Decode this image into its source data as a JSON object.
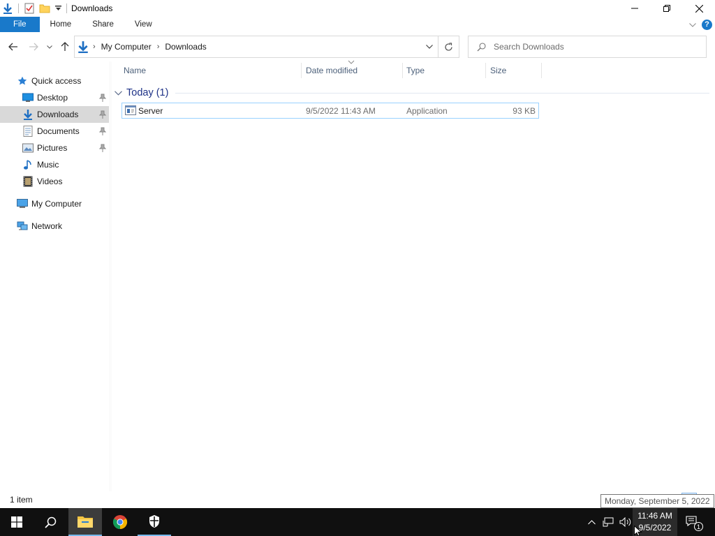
{
  "window": {
    "title": "Downloads"
  },
  "ribbon": {
    "tabs": [
      "File",
      "Home",
      "Share",
      "View"
    ]
  },
  "address": {
    "crumbs": [
      "My Computer",
      "Downloads"
    ]
  },
  "search": {
    "placeholder": "Search Downloads"
  },
  "nav_pane": {
    "quick_access": "Quick access",
    "items": [
      {
        "label": "Desktop",
        "icon": "desktop-icon",
        "pinned": true
      },
      {
        "label": "Downloads",
        "icon": "downloads-icon",
        "pinned": true,
        "selected": true
      },
      {
        "label": "Documents",
        "icon": "documents-icon",
        "pinned": true
      },
      {
        "label": "Pictures",
        "icon": "pictures-icon",
        "pinned": true
      },
      {
        "label": "Music",
        "icon": "music-icon",
        "pinned": false
      },
      {
        "label": "Videos",
        "icon": "videos-icon",
        "pinned": false
      }
    ],
    "my_computer": "My Computer",
    "network": "Network"
  },
  "columns": [
    "Name",
    "Date modified",
    "Type",
    "Size"
  ],
  "group": {
    "title": "Today (1)"
  },
  "files": [
    {
      "name": "Server",
      "date_modified": "9/5/2022 11:43 AM",
      "type": "Application",
      "size": "93 KB"
    }
  ],
  "status": {
    "item_count": "1 item"
  },
  "taskbar": {
    "time": "11:46 AM",
    "date": "9/5/2022",
    "tooltip": "Monday, September 5, 2022",
    "notifications": "1"
  },
  "colors": {
    "accent": "#1979ca",
    "selection_border": "#99d1ff",
    "group_title": "#1e3287"
  }
}
